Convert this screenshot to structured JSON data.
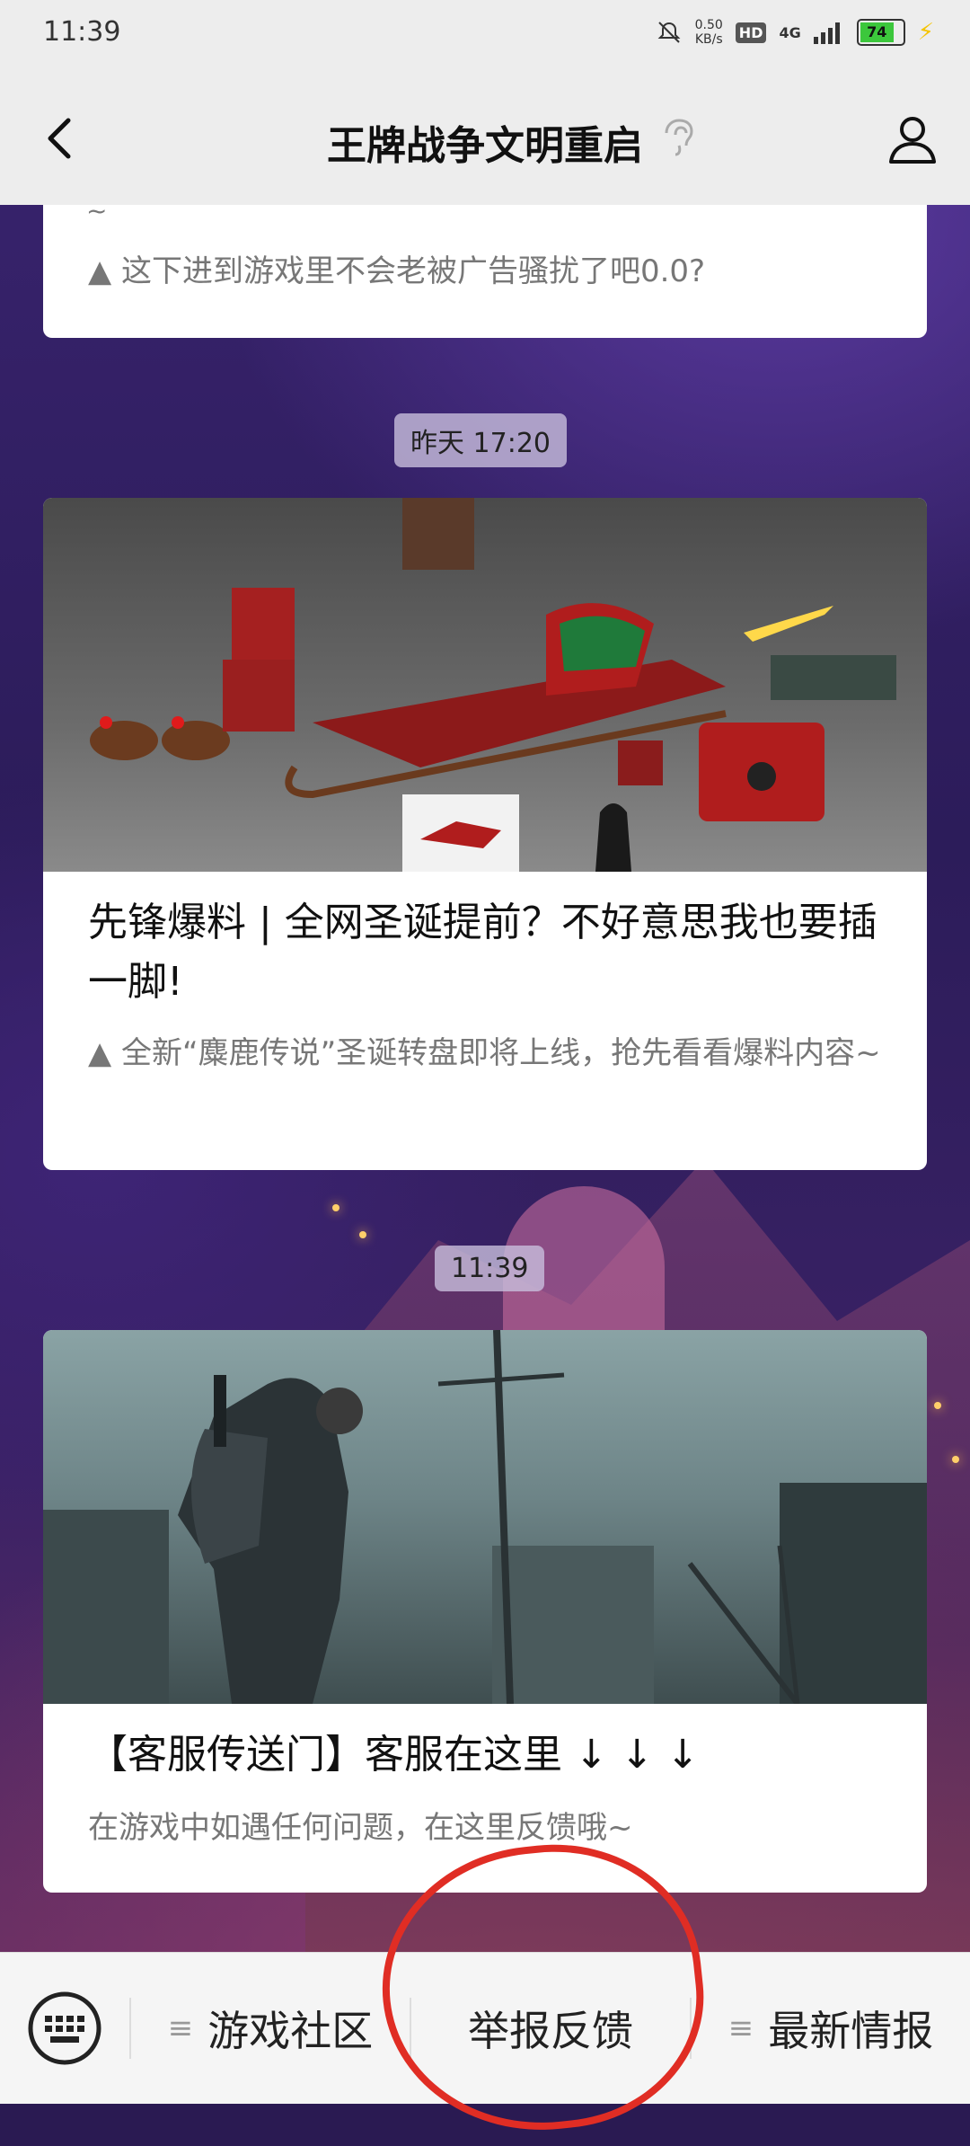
{
  "status_bar": {
    "time": "11:39",
    "net_speed_value": "0.50",
    "net_speed_unit": "KB/s",
    "hd": "HD",
    "network": "4G",
    "battery": "74"
  },
  "nav": {
    "title": "王牌战争文明重启"
  },
  "feed": {
    "card1": {
      "tilde": "~",
      "digest": "▲ 这下进到游戏里不会老被广告骚扰了吧0.0?"
    },
    "time1": "昨天 17:20",
    "card2": {
      "title": "先锋爆料 | 全网圣诞提前？不好意思我也要插一脚!",
      "digest": "▲ 全新“麋鹿传说”圣诞转盘即将上线，抢先看看爆料内容~"
    },
    "time2": "11:39",
    "card3": {
      "title": "【客服传送门】客服在这里 ↓ ↓ ↓",
      "digest": "在游戏中如遇任何问题，在这里反馈哦~"
    }
  },
  "menu": {
    "items": [
      {
        "label": "游戏社区"
      },
      {
        "label": "举报反馈"
      },
      {
        "label": "最新情报"
      }
    ],
    "lines_icon": "≡"
  },
  "colors": {
    "annotation": "#e02d24",
    "battery": "#3cc73c"
  }
}
